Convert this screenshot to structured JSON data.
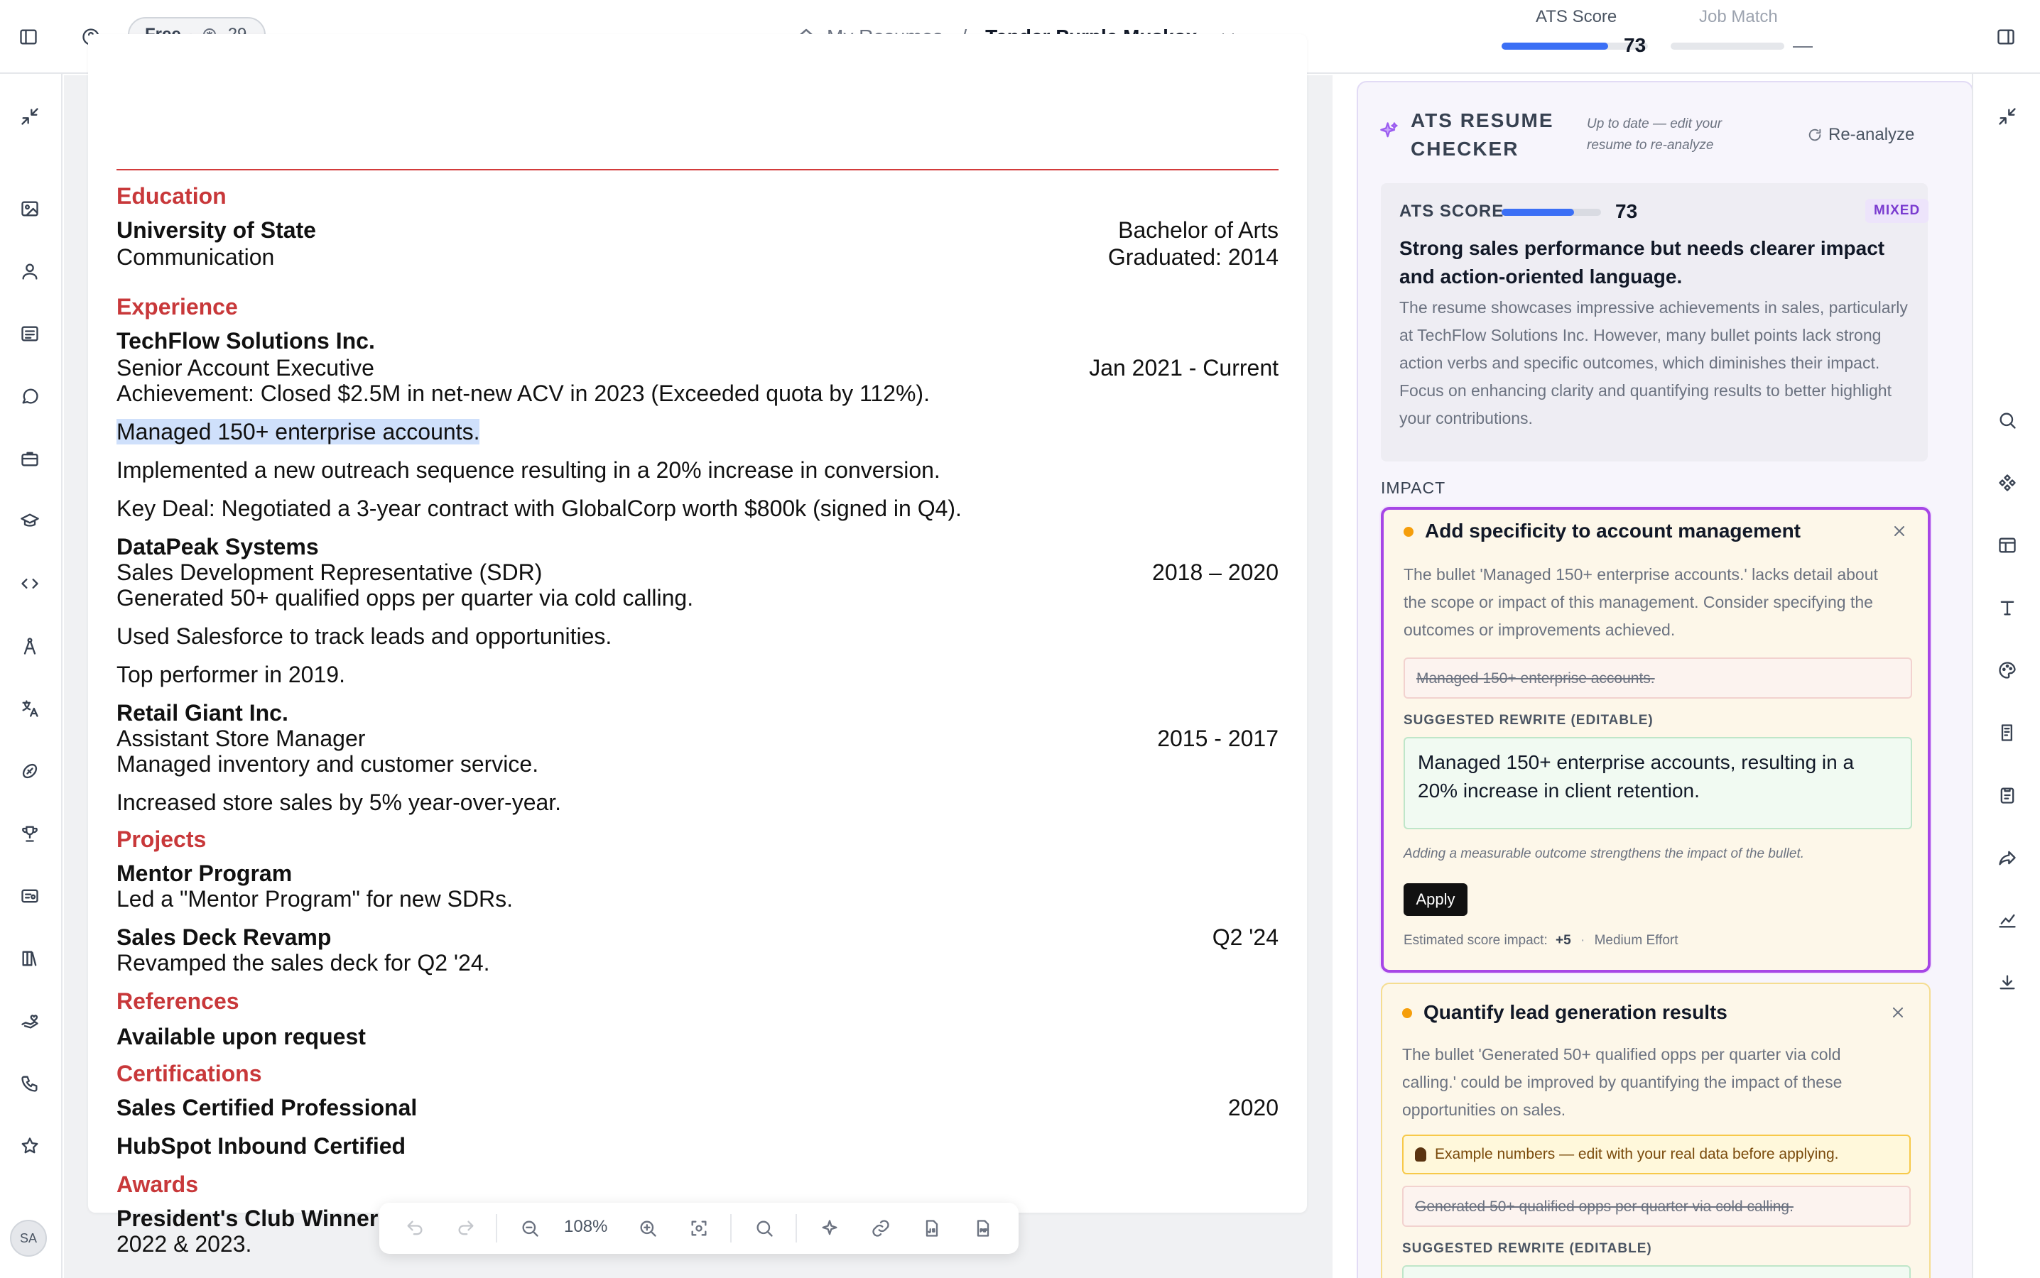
{
  "topbar": {
    "plan_label": "Free",
    "credits": "29",
    "breadcrumb_home": "My Resumes",
    "breadcrumb_sep": "/",
    "resume_name": "Tender Purple Muskox",
    "ats_label": "ATS Score",
    "ats_score": "73",
    "ats_progress": 0.73,
    "job_match_label": "Job Match",
    "job_match_value": "—"
  },
  "resume": {
    "education_heading": "Education",
    "school": "University of State",
    "major": "Communication",
    "degree": "Bachelor of Arts",
    "graduated": "Graduated: 2014",
    "experience_heading": "Experience",
    "job1_company": "TechFlow Solutions Inc.",
    "job1_title": "Senior Account Executive",
    "job1_dates": "Jan 2021 - Current",
    "job1_bullet1": "Achievement: Closed $2.5M in net-new ACV in 2023 (Exceeded quota by 112%).",
    "job1_bullet2": "Managed 150+ enterprise accounts.",
    "job1_bullet3": "Implemented a new outreach sequence resulting in a 20% increase in conversion.",
    "job1_bullet4": "Key Deal: Negotiated a 3-year contract with GlobalCorp worth $800k (signed in Q4).",
    "job2_company": "DataPeak Systems",
    "job2_title": "Sales Development Representative (SDR)",
    "job2_dates": "2018 – 2020",
    "job2_bullet1": "Generated 50+ qualified opps per quarter via cold calling.",
    "job2_bullet2": "Used Salesforce to track leads and opportunities.",
    "job2_bullet3": "Top performer in 2019.",
    "job3_company": "Retail Giant Inc.",
    "job3_title": "Assistant Store Manager",
    "job3_dates": "2015 - 2017",
    "job3_bullet1": "Managed inventory and customer service.",
    "job3_bullet2": "Increased store sales by 5% year-over-year.",
    "projects_heading": "Projects",
    "proj1_name": "Mentor Program",
    "proj1_desc": "Led a \"Mentor Program\" for new SDRs.",
    "proj2_name": "Sales Deck Revamp",
    "proj2_date": "Q2 '24",
    "proj2_desc": "Revamped the sales deck for Q2 '24.",
    "references_heading": "References",
    "references_text": "Available upon request",
    "certifications_heading": "Certifications",
    "cert1": "Sales Certified Professional",
    "cert1_year": "2020",
    "cert2": "HubSpot Inbound Certified",
    "awards_heading": "Awards",
    "award1": "President's Club Winner",
    "award1_years": "2022 & 2023."
  },
  "toolbar": {
    "zoom": "108%"
  },
  "panel": {
    "title_line1": "ATS RESUME",
    "title_line2": "CHECKER",
    "subtitle": "Up to date — edit your resume to re-analyze",
    "reanalyze_label": "Re-analyze",
    "summary": {
      "label": "ATS SCORE",
      "score": "73",
      "progress": 0.73,
      "badge": "MIXED",
      "headline": "Strong sales performance but needs clearer impact and action-oriented language.",
      "body": "The resume showcases impressive achievements in sales, particularly at TechFlow Solutions Inc. However, many bullet points lack strong action verbs and specific outcomes, which diminishes their impact. Focus on enhancing clarity and quantifying results to better highlight your contributions."
    },
    "impact_label": "IMPACT",
    "card1": {
      "title": "Add specificity to account management",
      "body": "The bullet 'Managed 150+ enterprise accounts.' lacks detail about the scope or impact of this management. Consider specifying the outcomes or improvements achieved.",
      "original": "Managed 150+ enterprise accounts.",
      "rewrite_label": "SUGGESTED REWRITE (EDITABLE)",
      "rewrite": "Managed 150+ enterprise accounts, resulting in a 20% increase in client retention.",
      "note": "Adding a measurable outcome strengthens the impact of the bullet.",
      "apply_label": "Apply",
      "est_label": "Estimated score impact:",
      "est_value": "+5",
      "effort": "Medium Effort"
    },
    "card2": {
      "title": "Quantify lead generation results",
      "body": "The bullet 'Generated 50+ qualified opps per quarter via cold calling.' could be improved by quantifying the impact of these opportunities on sales.",
      "warning": "Example numbers — edit with your real data before applying.",
      "original": "Generated 50+ qualified opps per quarter via cold calling.",
      "rewrite_label": "SUGGESTED REWRITE (EDITABLE)"
    }
  },
  "user": {
    "initials": "SA"
  }
}
